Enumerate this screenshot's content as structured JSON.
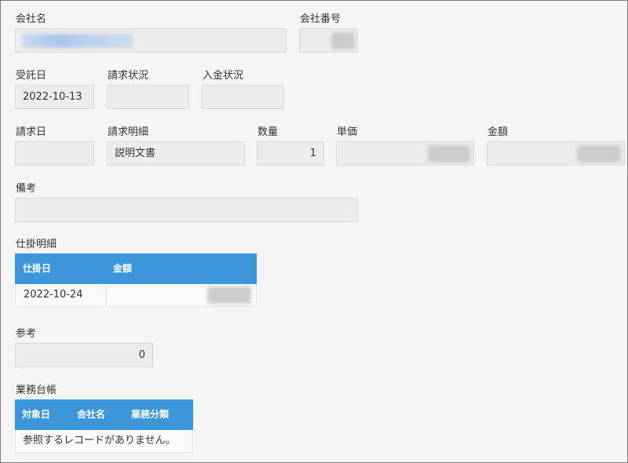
{
  "company": {
    "name_label": "会社名",
    "name_value": "",
    "number_label": "会社番号",
    "number_value": ""
  },
  "row2": {
    "consign_date_label": "受託日",
    "consign_date_value": "2022-10-13",
    "billing_status_label": "請求状況",
    "billing_status_value": "",
    "payment_status_label": "入金状況",
    "payment_status_value": ""
  },
  "row3": {
    "billing_date_label": "請求日",
    "billing_date_value": "",
    "billing_detail_label": "請求明細",
    "billing_detail_value": "説明文書",
    "quantity_label": "数量",
    "quantity_value": "1",
    "unit_price_label": "単価",
    "unit_price_value": "",
    "amount_label": "金額",
    "amount_value": ""
  },
  "remarks": {
    "label": "備考",
    "value": ""
  },
  "wip": {
    "label": "仕掛明細",
    "headers": [
      "仕掛日",
      "金額"
    ],
    "rows": [
      {
        "date": "2022-10-24",
        "amount": ""
      }
    ]
  },
  "reference": {
    "label": "参考",
    "value": "0"
  },
  "ledger": {
    "label": "業務台帳",
    "headers": [
      "対象日",
      "会社名",
      "業務分類"
    ],
    "empty_message": "参照するレコードがありません。"
  }
}
